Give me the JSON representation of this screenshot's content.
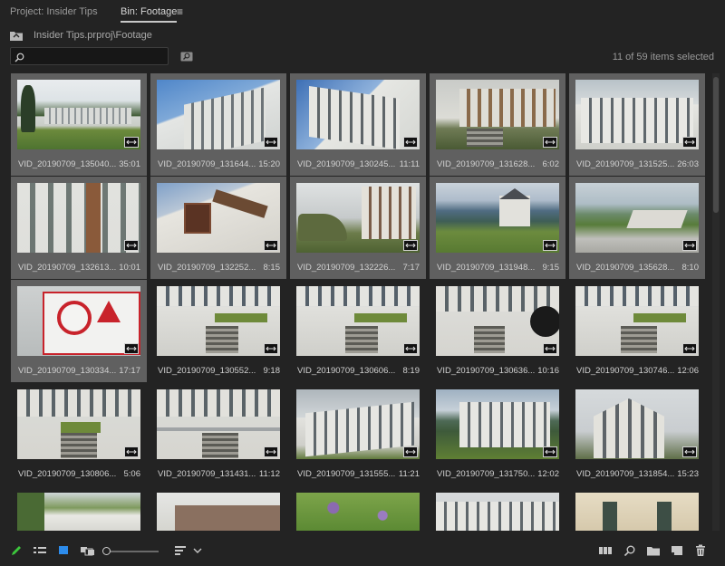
{
  "tabs": {
    "project": "Project: Insider Tips",
    "bin": "Bin: Footage",
    "menu_icon": "hamburger-icon"
  },
  "path": {
    "text": "Insider Tips.prproj\\Footage",
    "icon": "bin-up-icon"
  },
  "search": {
    "value": "",
    "placeholder": ""
  },
  "selection": {
    "text": "11 of 59 items selected"
  },
  "clips": [
    {
      "name": "VID_20190709_135040...",
      "dur": "35:01",
      "selected": true
    },
    {
      "name": "VID_20190709_131644...",
      "dur": "15:20",
      "selected": true
    },
    {
      "name": "VID_20190709_130245...",
      "dur": "11:11",
      "selected": true
    },
    {
      "name": "VID_20190709_131628...",
      "dur": "6:02",
      "selected": true
    },
    {
      "name": "VID_20190709_131525...",
      "dur": "26:03",
      "selected": true
    },
    {
      "name": "VID_20190709_132613...",
      "dur": "10:01",
      "selected": true
    },
    {
      "name": "VID_20190709_132252...",
      "dur": "8:15",
      "selected": true
    },
    {
      "name": "VID_20190709_132226...",
      "dur": "7:17",
      "selected": true
    },
    {
      "name": "VID_20190709_131948...",
      "dur": "9:15",
      "selected": true
    },
    {
      "name": "VID_20190709_135628...",
      "dur": "8:10",
      "selected": true
    },
    {
      "name": "VID_20190709_130334...",
      "dur": "17:17",
      "selected": true
    },
    {
      "name": "VID_20190709_130552...",
      "dur": "9:18",
      "selected": false
    },
    {
      "name": "VID_20190709_130606...",
      "dur": "8:19",
      "selected": false
    },
    {
      "name": "VID_20190709_130636...",
      "dur": "10:16",
      "selected": false
    },
    {
      "name": "VID_20190709_130746...",
      "dur": "12:06",
      "selected": false
    },
    {
      "name": "VID_20190709_130806...",
      "dur": "5:06",
      "selected": false
    },
    {
      "name": "VID_20190709_131431...",
      "dur": "11:12",
      "selected": false
    },
    {
      "name": "VID_20190709_131555...",
      "dur": "11:21",
      "selected": false
    },
    {
      "name": "VID_20190709_131750...",
      "dur": "12:02",
      "selected": false
    },
    {
      "name": "VID_20190709_131854...",
      "dur": "15:23",
      "selected": false
    }
  ],
  "colors": {
    "selected_tile": "#606060",
    "background": "#232323",
    "pencil": "#3cc83c",
    "accent_blue": "#2d8ceb"
  },
  "footer": {
    "icons": [
      "pencil-icon",
      "list-view-icon",
      "icon-view-icon",
      "freeform-view-icon",
      "zoom-slider",
      "sort-icon",
      "chevron-down-icon",
      "automate-to-sequence-icon",
      "find-icon",
      "new-bin-icon",
      "new-item-icon",
      "trash-icon"
    ]
  }
}
